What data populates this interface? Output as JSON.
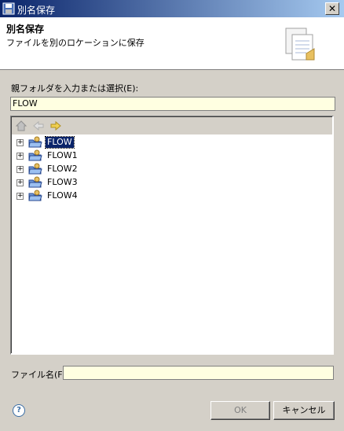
{
  "window": {
    "title": "別名保存",
    "close_glyph": "✕"
  },
  "header": {
    "title": "別名保存",
    "subtitle": "ファイルを別のロケーションに保存"
  },
  "folder": {
    "label": "親フォルダを入力または選択(E):",
    "value": "FLOW"
  },
  "tree": {
    "items": [
      {
        "label": "FLOW",
        "selected": true
      },
      {
        "label": "FLOW1",
        "selected": false
      },
      {
        "label": "FLOW2",
        "selected": false
      },
      {
        "label": "FLOW3",
        "selected": false
      },
      {
        "label": "FLOW4",
        "selected": false
      }
    ],
    "expander_glyph": "+"
  },
  "filename": {
    "label": "ファイル名(F):",
    "value": ""
  },
  "help_glyph": "?",
  "buttons": {
    "ok": "OK",
    "cancel": "キャンセル"
  },
  "colors": {
    "title_bar": "#0a246a",
    "input_bg": "#ffffe1",
    "selection": "#0a246a"
  }
}
